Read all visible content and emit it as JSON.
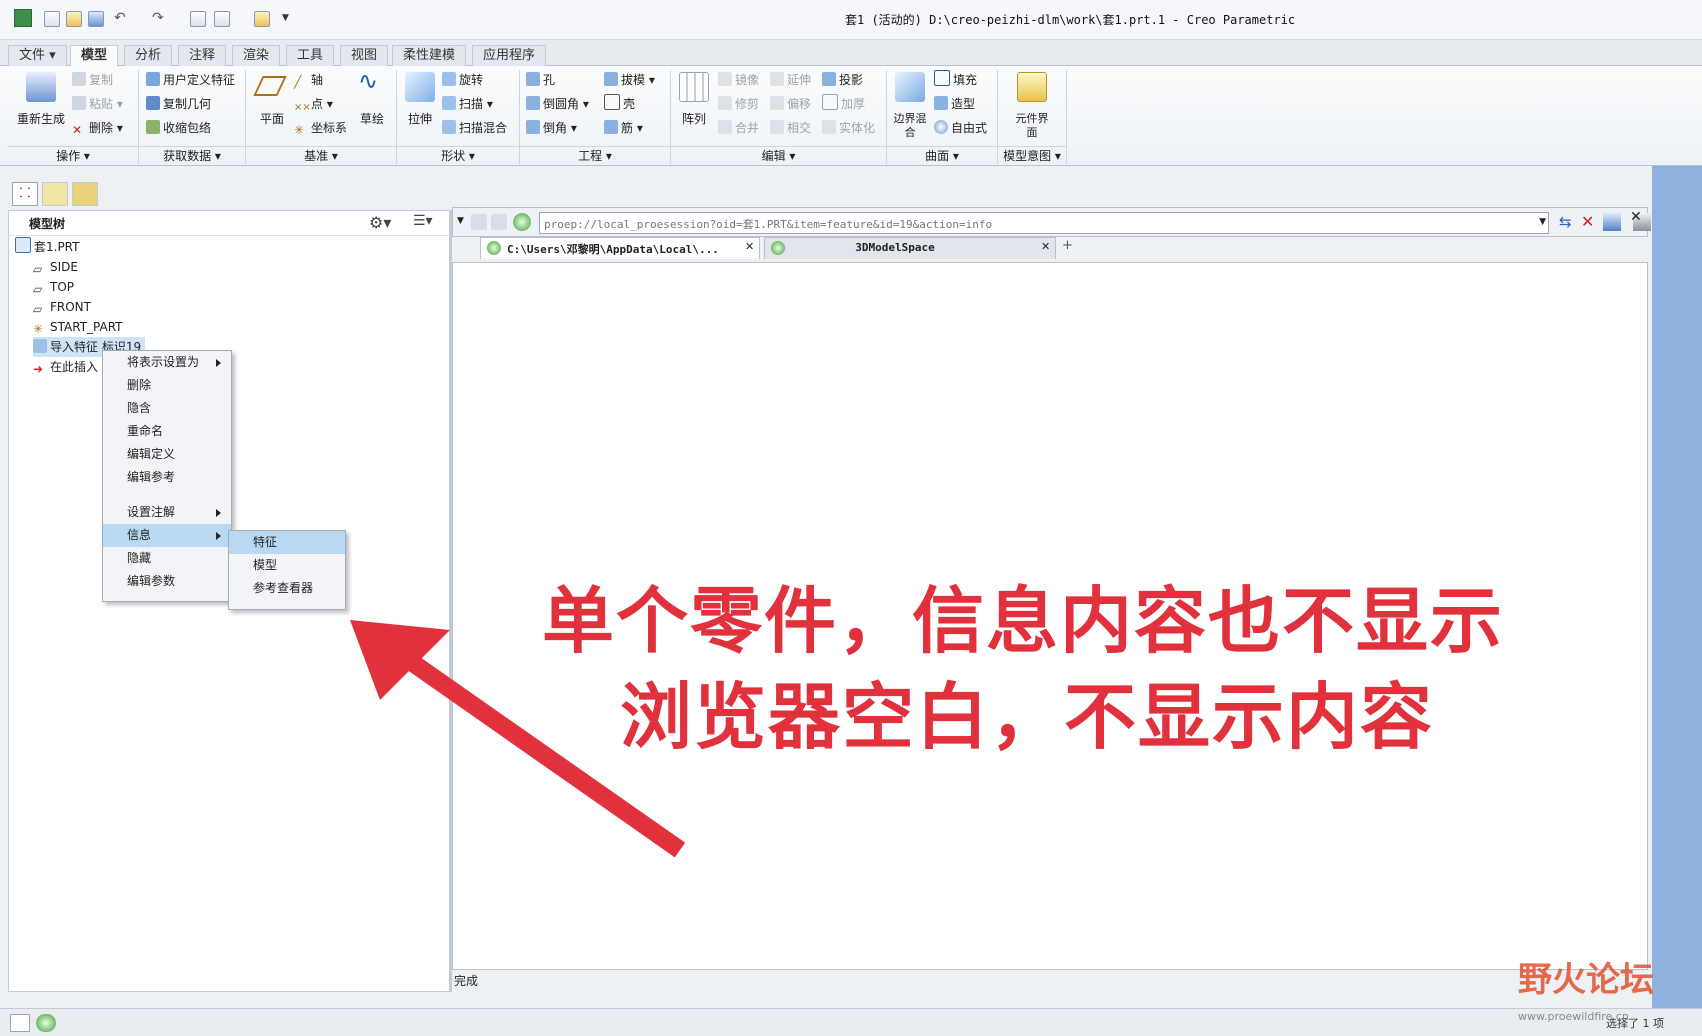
{
  "window": {
    "title": "套1 (活动的) D:\\creo-peizhi-dlm\\work\\套1.prt.1 - Creo Parametric"
  },
  "tabs": [
    "文件",
    "模型",
    "分析",
    "注释",
    "渲染",
    "工具",
    "视图",
    "柔性建模",
    "应用程序"
  ],
  "ribbon": {
    "operations": {
      "regen": "重新生成",
      "copy": "复制",
      "paste": "粘贴",
      "delete": "删除",
      "label": "操作"
    },
    "get_data": {
      "udf": "用户定义特征",
      "copy_geom": "复制几何",
      "shrinkwrap": "收缩包络",
      "label": "获取数据"
    },
    "datum": {
      "plane": "平面",
      "axis": "轴",
      "point": "点",
      "csys": "坐标系",
      "sketch": "草绘",
      "label": "基准"
    },
    "shapes": {
      "extrude": "拉伸",
      "revolve": "旋转",
      "sweep": "扫描",
      "swept_blend": "扫描混合",
      "label": "形状"
    },
    "engineering": {
      "hole": "孔",
      "round": "倒圆角",
      "chamfer": "倒角",
      "draft": "拔模",
      "shell": "壳",
      "rib": "筋",
      "label": "工程"
    },
    "editing": {
      "pattern": "阵列",
      "mirror": "镜像",
      "trim": "修剪",
      "merge": "合并",
      "extend": "延伸",
      "offset": "偏移",
      "intersect": "相交",
      "project": "投影",
      "thicken": "加厚",
      "solidify": "实体化",
      "label": "编辑"
    },
    "surfaces": {
      "boundary": "边界混合",
      "fill": "填充",
      "style": "造型",
      "freestyle": "自由式",
      "label": "曲面"
    },
    "intent": {
      "component": "元件界面",
      "label": "模型意图"
    }
  },
  "model_tree": {
    "header": "模型树",
    "items": [
      "套1.PRT",
      "SIDE",
      "TOP",
      "FRONT",
      "START_PART",
      "导入特征 标识19",
      "在此插入"
    ]
  },
  "browser": {
    "url": "proep://local_proesession?oid=套1.PRT&item=feature&id=19&action=info",
    "tab1": "C:\\Users\\邓黎明\\AppData\\Local\\...",
    "tab2": "3DModelSpace",
    "status": "完成"
  },
  "context_menu": {
    "items": [
      "将表示设置为",
      "删除",
      "隐含",
      "重命名",
      "编辑定义",
      "编辑参考",
      "设置注解",
      "信息",
      "隐藏",
      "编辑参数"
    ],
    "submenu": [
      "特征",
      "模型",
      "参考查看器"
    ]
  },
  "annotation": {
    "line1": "单个零件，信息内容也不显示",
    "line2": "浏览器空白，不显示内容"
  },
  "watermark": {
    "logo": "野火论坛",
    "url": "www.proewildfire.cn"
  },
  "statusbar": {
    "right": "选择了 1 项"
  },
  "colors": {
    "accent_red": "#e0313d",
    "highlight": "#b9d8f2",
    "side_blue": "#8fb1dd"
  }
}
